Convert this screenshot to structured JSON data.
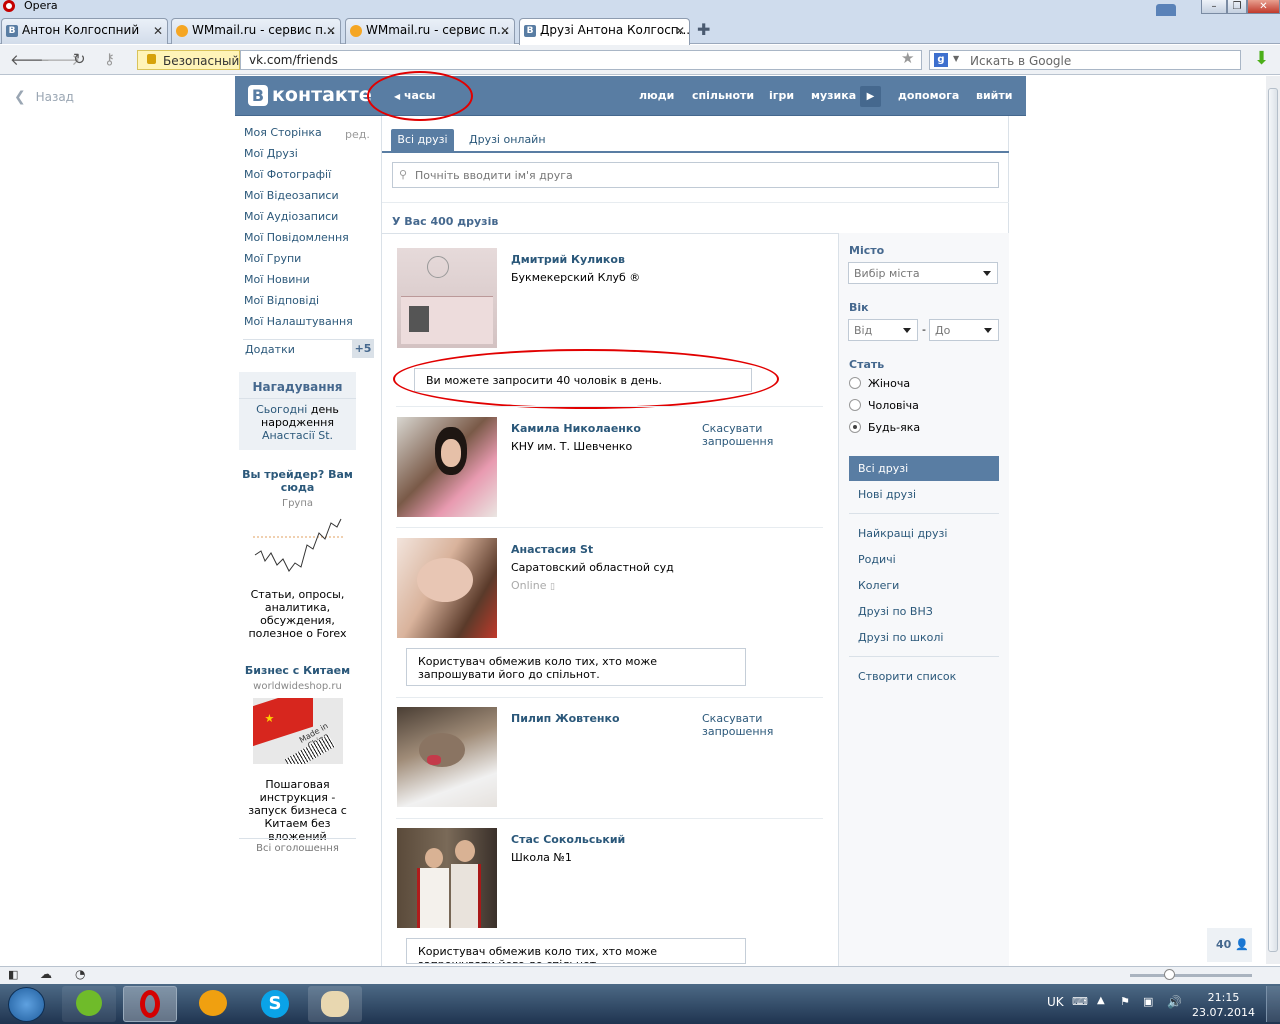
{
  "browser": {
    "app_title": "Opera",
    "tabs": [
      {
        "label": "Антон Колгоспний",
        "icon": "vk-icon"
      },
      {
        "label": "WMmail.ru - сервис п...",
        "icon": "wmmail-icon"
      },
      {
        "label": "WMmail.ru - сервис п...",
        "icon": "wmmail-icon"
      },
      {
        "label": "Друзі Антона Колгосп...",
        "icon": "vk-icon"
      }
    ],
    "security_label": "Безопасный",
    "url": "vk.com/friends",
    "search_placeholder": "Искать в Google"
  },
  "page": {
    "back_label": "Назад",
    "logo_letter": "В",
    "logo_text": "контакте",
    "header_link": "часы",
    "nav": [
      "люди",
      "спільноти",
      "ігри",
      "музика",
      "допомога",
      "вийти"
    ],
    "left_menu": [
      "Моя Сторінка",
      "Мої Друзі",
      "Мої Фотографії",
      "Мої Відеозаписи",
      "Мої Аудіозаписи",
      "Мої Повідомлення",
      "Мої Групи",
      "Мої Новини",
      "Мої Відповіді",
      "Мої Налаштування"
    ],
    "left_menu_edit": "ред.",
    "apps_label": "Додатки",
    "apps_badge": "+5",
    "reminder": {
      "title": "Нагадування",
      "text_pre": "Сьогодні",
      "text_mid": "день народження",
      "text_link": "Анастасії St."
    },
    "ads": [
      {
        "title": "Вы трейдер? Вам сюда",
        "subtitle": "Група",
        "body": "Статьи, опросы, аналитика, обсуждения, полезное о Forex"
      },
      {
        "title": "Бизнес с Китаем",
        "subtitle": "worldwideshop.ru",
        "body": "Пошаговая инструкция - запуск бизнеса с Китаем без вложений",
        "img_text": "Made in China"
      }
    ],
    "ads_all": "Всі оголошення",
    "tabs": [
      "Всі друзі",
      "Друзі онлайн"
    ],
    "search_placeholder": "Почніть вводити ім'я друга",
    "friends_count": "У Вас 400 друзів",
    "invite_note": "Ви можете запросити 40 чоловік в день.",
    "restriction_note": "Користувач обмежив коло тих, хто може запрошувати його до спільнот.",
    "cancel_label": "Скасувати запрошення",
    "friends": [
      {
        "name": "Дмитрий Куликов",
        "sub": "Букмекерский Клуб ®",
        "status": ""
      },
      {
        "name": "Камила Николаенко",
        "sub": "КНУ им. Т. Шевченко",
        "status": ""
      },
      {
        "name": "Анастасия St",
        "sub": "Саратовский областной суд",
        "status": "Online"
      },
      {
        "name": "Пилип Жовтенко",
        "sub": "",
        "status": ""
      },
      {
        "name": "Стас Сокольський",
        "sub": "Школа №1",
        "status": ""
      }
    ],
    "filters": {
      "city_label": "Місто",
      "city_value": "Вибір міста",
      "age_label": "Вік",
      "age_from": "Від",
      "age_dash": "-",
      "age_to": "До",
      "sex_label": "Стать",
      "sex_options": [
        "Жіноча",
        "Чоловіча",
        "Будь-яка"
      ],
      "sex_selected": 2,
      "lists": [
        "Всі друзі",
        "Нові друзі",
        "Найкращі друзі",
        "Родичі",
        "Колеги",
        "Друзі по ВНЗ",
        "Друзі по школі",
        "Створити список"
      ]
    },
    "people_count": "40"
  },
  "taskbar": {
    "lang": "UK",
    "time": "21:15",
    "date": "23.07.2014"
  },
  "colors": {
    "vk_blue": "#597da3",
    "link": "#2b587a",
    "annotation_red": "#e10000"
  }
}
